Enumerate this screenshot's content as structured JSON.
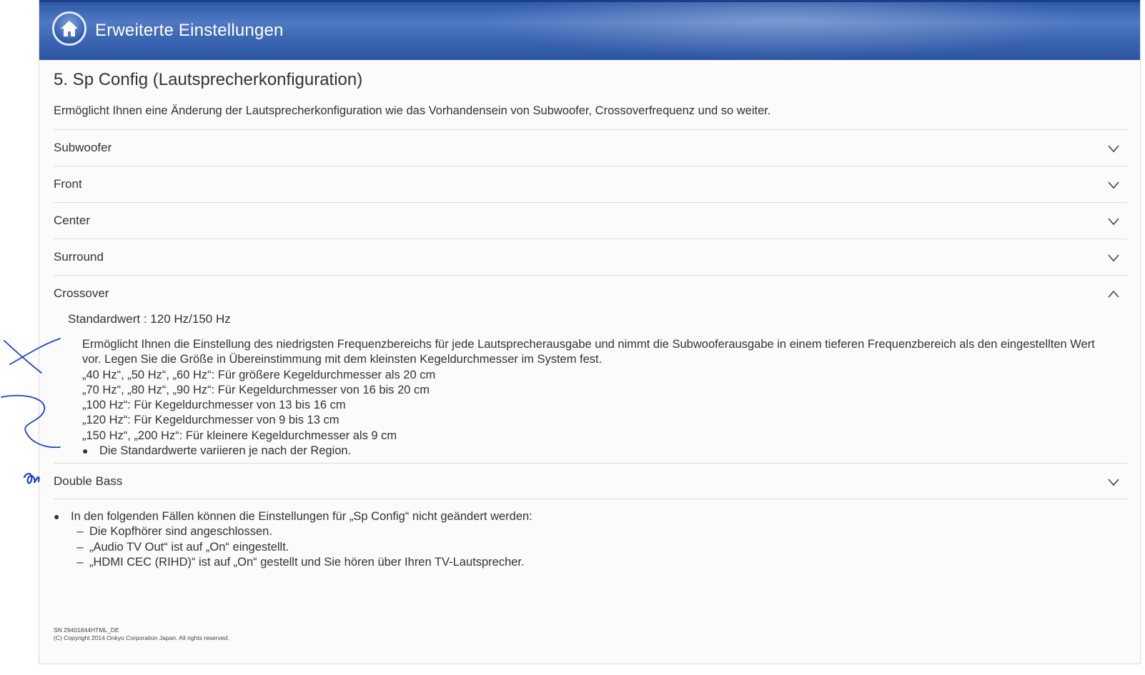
{
  "header": {
    "title": "Erweiterte Einstellungen",
    "home_icon": "home-icon"
  },
  "page": {
    "title": "5. Sp Config (Lautsprecherkonfiguration)",
    "description": "Ermöglicht Ihnen eine Änderung der Lautsprecherkonfiguration wie das Vorhandensein von Subwoofer, Crossoverfrequenz und so weiter."
  },
  "accordion": [
    {
      "label": "Subwoofer",
      "expanded": false
    },
    {
      "label": "Front",
      "expanded": false
    },
    {
      "label": "Center",
      "expanded": false
    },
    {
      "label": "Surround",
      "expanded": false
    },
    {
      "label": "Crossover",
      "expanded": true
    },
    {
      "label": "Double Bass",
      "expanded": false
    }
  ],
  "crossover": {
    "default": "Standardwert : 120 Hz/150 Hz",
    "intro": "Ermöglicht Ihnen die Einstellung des niedrigsten Frequenzbereichs für jede Lautsprecherausgabe und nimmt die Subwooferausgabe in einem tieferen Frequenzbereich als den eingestellten Wert vor. Legen Sie die Größe in Übereinstimmung mit dem kleinsten Kegeldurchmesser im System fest.",
    "options": [
      "„40 Hz“, „50 Hz“, „60 Hz“: Für größere Kegeldurchmesser als 20 cm",
      "„70 Hz“, „80 Hz“, „90 Hz“: Für Kegeldurchmesser von 16 bis 20 cm",
      "„100 Hz“: Für Kegeldurchmesser von 13 bis 16 cm",
      "„120 Hz“: Für Kegeldurchmesser von 9 bis 13 cm",
      "„150 Hz“, „200 Hz“: Für kleinere Kegeldurchmesser als 9 cm"
    ],
    "note": "Die Standardwerte variieren je nach der Region."
  },
  "notes": {
    "main": "In den folgenden Fällen können die Einstellungen für „Sp Config“ nicht geändert werden:",
    "items": [
      "Die Kopfhörer sind angeschlossen.",
      "„Audio TV Out“ ist auf „On“ eingestellt.",
      "„HDMI CEC (RIHD)“ ist auf „On“ gestellt und Sie hören über Ihren TV-Lautsprecher."
    ]
  },
  "footer": {
    "serial": "SN 29401844HTML_DE",
    "copyright": "(C) Copyright 2014 Onkyo Corporation Japan. All rights reserved."
  },
  "colors": {
    "header": "#3a64b0",
    "text": "#333333",
    "divider": "#dcdcdc",
    "annotation": "#1d3fd6"
  }
}
